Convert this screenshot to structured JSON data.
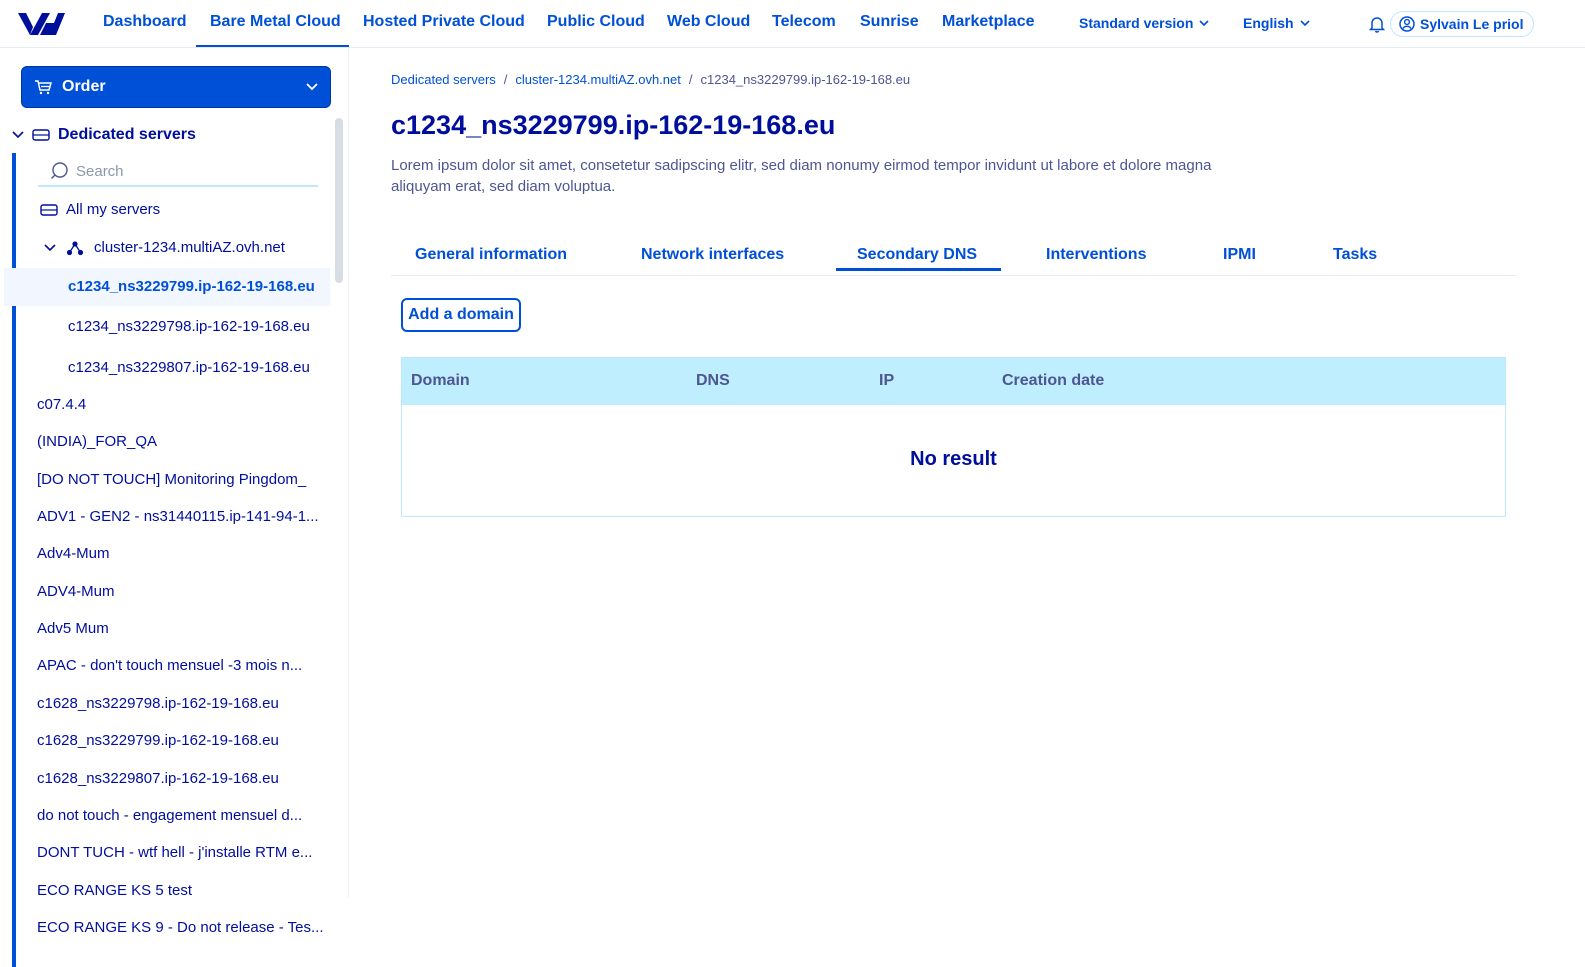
{
  "topnav": {
    "items": [
      "Dashboard",
      "Bare Metal Cloud",
      "Hosted Private Cloud",
      "Public Cloud",
      "Web Cloud",
      "Telecom",
      "Sunrise",
      "Marketplace"
    ],
    "active": "Bare Metal Cloud",
    "version_label": "Standard version",
    "language_label": "English",
    "user_name": "Sylvain Le priol"
  },
  "sidebar": {
    "order_label": "Order",
    "tree_title": "Dedicated servers",
    "search_placeholder": "Search",
    "all_servers_label": "All my servers",
    "cluster_label": "cluster-1234.multiAZ.ovh.net",
    "cluster_children": [
      "c1234_ns3229799.ip-162-19-168.eu",
      "c1234_ns3229798.ip-162-19-168.eu",
      "c1234_ns3229807.ip-162-19-168.eu"
    ],
    "selected_child": "c1234_ns3229799.ip-162-19-168.eu",
    "servers": [
      "c07.4.4",
      "(INDIA)_FOR_QA",
      "[DO NOT TOUCH] Monitoring Pingdom_",
      "ADV1 - GEN2 - ns31440115.ip-141-94-1...",
      "Adv4-Mum",
      "ADV4-Mum",
      "Adv5 Mum",
      "APAC - don't touch mensuel -3 mois n...",
      "c1628_ns3229798.ip-162-19-168.eu",
      "c1628_ns3229799.ip-162-19-168.eu",
      "c1628_ns3229807.ip-162-19-168.eu",
      "do not touch - engagement mensuel d...",
      "DONT TUCH - wtf hell - j'installe RTM e...",
      "ECO RANGE KS 5 test",
      "ECO RANGE KS 9 - Do not release - Tes..."
    ]
  },
  "breadcrumb": [
    "Dedicated servers",
    "cluster-1234.multiAZ.ovh.net",
    "c1234_ns3229799.ip-162-19-168.eu"
  ],
  "page": {
    "title": "c1234_ns3229799.ip-162-19-168.eu",
    "description": "Lorem ipsum dolor sit amet, consetetur sadipscing elitr, sed diam nonumy eirmod tempor invidunt ut labore et dolore magna aliquyam erat, sed diam voluptua."
  },
  "tabs": [
    "General information",
    "Network interfaces",
    "Secondary DNS",
    "Interventions",
    "IPMI",
    "Tasks"
  ],
  "active_tab": "Secondary DNS",
  "add_domain_label": "Add a domain",
  "table": {
    "columns": [
      "Domain",
      "DNS",
      "IP",
      "Creation date"
    ],
    "empty_label": "No result"
  },
  "colors": {
    "primary": "#0050d7",
    "dark": "#000e9c",
    "table_header": "#bfeeff"
  }
}
